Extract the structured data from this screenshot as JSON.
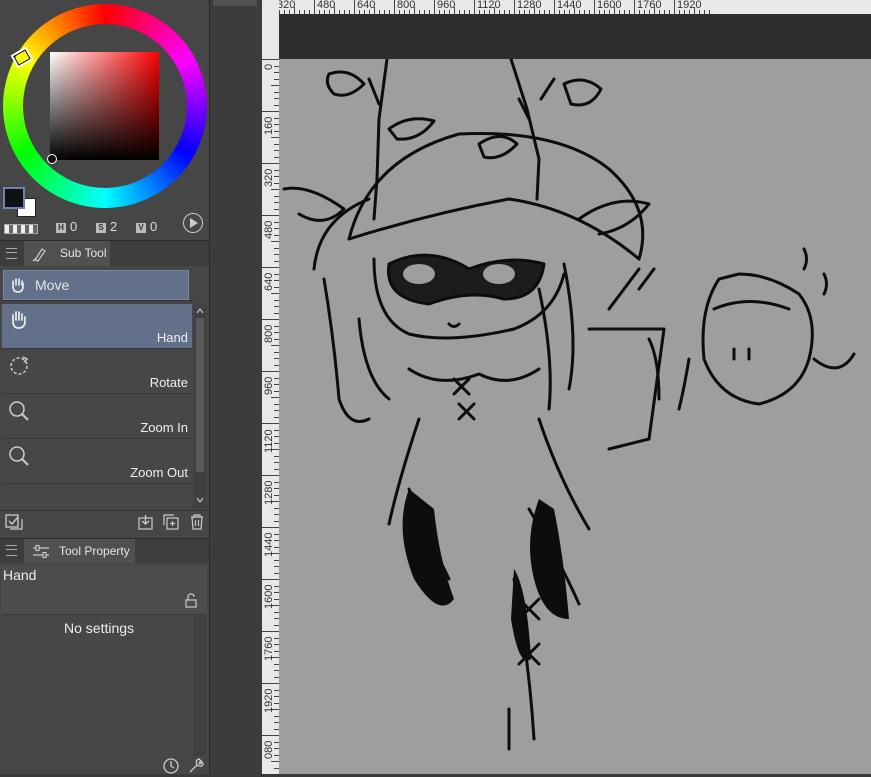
{
  "color": {
    "main_color": "#111111",
    "sub_color": "#ffffff",
    "hsv": {
      "h_label": "H",
      "h": "0",
      "s_label": "S",
      "s": "2",
      "v_label": "V",
      "v": "0"
    }
  },
  "subtool": {
    "tab_label": "Sub Tool",
    "group_label": "Move",
    "items": [
      {
        "label": "Hand",
        "icon": "hand-icon",
        "selected": true
      },
      {
        "label": "Rotate",
        "icon": "rotate-icon",
        "selected": false
      },
      {
        "label": "Zoom In",
        "icon": "zoom-in-icon",
        "selected": false
      },
      {
        "label": "Zoom Out",
        "icon": "zoom-out-icon",
        "selected": false
      }
    ]
  },
  "toolprop": {
    "tab_label": "Tool Property",
    "tool_name": "Hand",
    "empty_message": "No settings"
  },
  "ruler": {
    "horizontal": [
      "320",
      "480",
      "640",
      "800",
      "960",
      "1120",
      "1280",
      "1440",
      "1600",
      "1760",
      "1920"
    ],
    "vertical": [
      "0",
      "160",
      "320",
      "480",
      "640",
      "800",
      "960",
      "1120",
      "1280",
      "1440",
      "1600",
      "1760",
      "1920",
      "080"
    ]
  },
  "colors": {
    "panel": "#464646",
    "selection": "#627089",
    "canvas": "#9e9e9e",
    "ruler": "#e8e8e8"
  }
}
